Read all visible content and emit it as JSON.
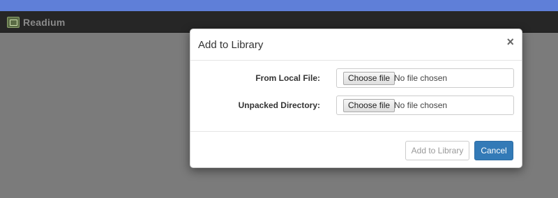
{
  "app": {
    "title": "Readium"
  },
  "modal": {
    "title": "Add to Library",
    "close_label": "×",
    "fields": [
      {
        "label": "From Local File:",
        "button": "Choose file",
        "status": "No file chosen"
      },
      {
        "label": "Unpacked Directory:",
        "button": "Choose file",
        "status": "No file chosen"
      }
    ],
    "footer": {
      "add_label": "Add to Library",
      "cancel_label": "Cancel"
    }
  },
  "colors": {
    "navbar": "#262626",
    "top_strip": "#5f7fd8",
    "backdrop": "#7b7b7b",
    "primary_button": "#337ab7"
  },
  "icons": {
    "logo": "readium-logo-icon"
  }
}
